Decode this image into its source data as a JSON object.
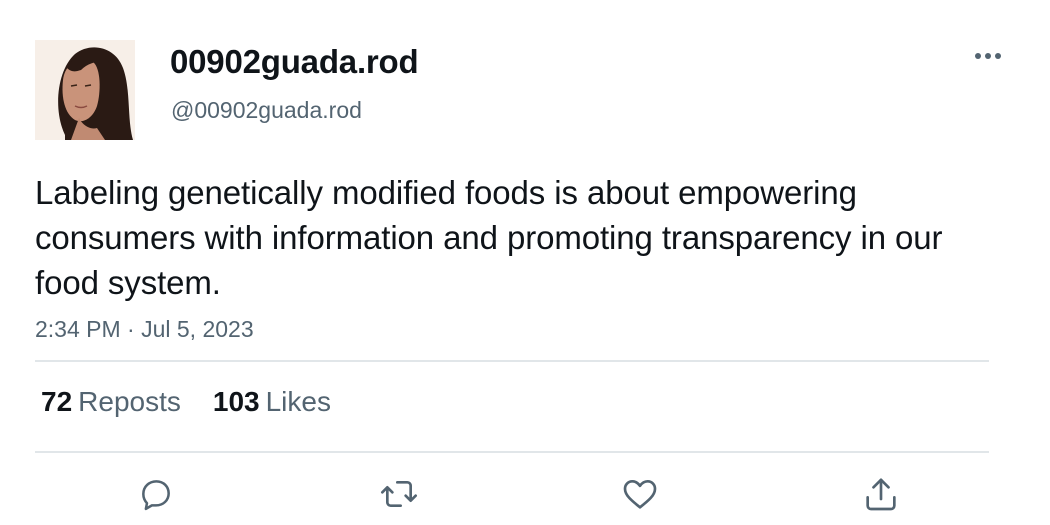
{
  "user": {
    "display_name": "00902guada.rod",
    "handle": "@00902guada.rod",
    "avatar": "profile-photo"
  },
  "tweet": {
    "text": "Labeling genetically modified foods is about empowering consumers with information and promoting transparency in our food system.",
    "timestamp": "2:34 PM · Jul 5, 2023"
  },
  "stats": {
    "reposts_count": "72",
    "reposts_label": "Reposts",
    "likes_count": "103",
    "likes_label": "Likes"
  },
  "icons": {
    "more": "more-icon",
    "reply": "reply-icon",
    "repost": "repost-icon",
    "like": "heart-icon",
    "share": "share-icon"
  },
  "colors": {
    "text_primary": "#0f1419",
    "text_secondary": "#536471",
    "divider": "#e1e6e9"
  }
}
